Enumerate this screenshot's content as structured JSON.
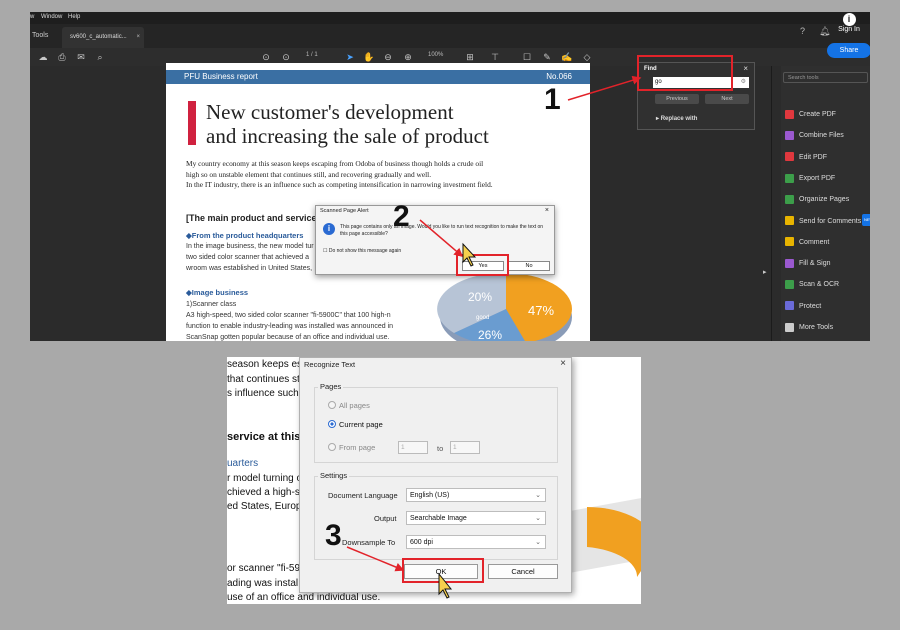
{
  "top": {
    "menu": [
      "w",
      "Window",
      "Help"
    ],
    "tools_tab": "Tools",
    "doc_tab": "sv600_c_automatic...",
    "page_indicator": "1 / 1",
    "zoom": "100%",
    "sign_in": "Sign In",
    "share": "Share",
    "page": {
      "banner_left": "PFU Business report",
      "banner_right": "No.066",
      "title_line1": "New customer's development",
      "title_line2": "and increasing the sale of product",
      "body1": "My country economy at this season keeps escaping from Odoba of business though holds a crude oil",
      "body2": "high so on unstable element that continues still, and recovering gradually and well.",
      "body3": "In the IT industry, there is an influence such as competing intensification in narrowing investment field.",
      "section": "[The main product and service a",
      "hq_heading": "◆From the product headquarters",
      "hq1": "In the image business, the new model tur",
      "hq2": "two sided color scanner that achieved a",
      "hq3": "wroom was established in United States,",
      "img_heading": "◆Image business",
      "img1": "1)Scanner class",
      "img2": "A3 high-speed, two sided color scanner \"fi-5900C\" that 100 high-n",
      "img3": "function to enable industry-leading was installed was announced in",
      "img4": "ScanSnap gotten popular because of an office and individual use.",
      "pie_labels": [
        "20%",
        "good",
        "26%",
        "47%"
      ]
    },
    "alert": {
      "title": "Scanned Page Alert",
      "message": "This page contains only an image. Would you like to run text recognition to make the text on this page accessible?",
      "dont_show": "Do not show this message again",
      "yes": "Yes",
      "no": "No"
    },
    "find": {
      "title": "Find",
      "value": "go",
      "previous": "Previous",
      "next": "Next",
      "replace": "Replace with"
    },
    "tools": {
      "search_placeholder": "Search tools",
      "items": [
        {
          "label": "Create PDF",
          "icon": "create-pdf-icon",
          "color": "#e0383e"
        },
        {
          "label": "Combine Files",
          "icon": "combine-files-icon",
          "color": "#9b59d0"
        },
        {
          "label": "Edit PDF",
          "icon": "edit-pdf-icon",
          "color": "#e0383e"
        },
        {
          "label": "Export PDF",
          "icon": "export-pdf-icon",
          "color": "#3c9e4a"
        },
        {
          "label": "Organize Pages",
          "icon": "organize-pages-icon",
          "color": "#3c9e4a"
        },
        {
          "label": "Send for Comments",
          "icon": "send-comments-icon",
          "color": "#e8b400"
        },
        {
          "label": "Comment",
          "icon": "comment-icon",
          "color": "#e8b400"
        },
        {
          "label": "Fill & Sign",
          "icon": "fill-sign-icon",
          "color": "#9b59d0"
        },
        {
          "label": "Scan & OCR",
          "icon": "scan-ocr-icon",
          "color": "#3c9e4a"
        },
        {
          "label": "Protect",
          "icon": "protect-icon",
          "color": "#6a6ad8"
        },
        {
          "label": "More Tools",
          "icon": "more-tools-icon",
          "color": "#cccccc"
        }
      ],
      "new_badge": "NEW"
    }
  },
  "bottom": {
    "bg_lines": [
      "season keeps esc",
      "that continues st",
      "s influence such",
      "service at this",
      "uarters",
      "r model turning o",
      "chieved a high-s",
      "ed States, Europ",
      "or scanner \"fi-59",
      "ading was instal",
      "use of an office and individual use."
    ],
    "dialog": {
      "title": "Recognize Text",
      "pages_label": "Pages",
      "all_pages": "All pages",
      "current_page": "Current page",
      "from_page": "From page",
      "from_value": "1",
      "to_label": "to",
      "to_value": "1",
      "settings_label": "Settings",
      "lang_label": "Document Language",
      "lang_value": "English (US)",
      "output_label": "Output",
      "output_value": "Searchable Image",
      "downsample_label": "Downsample To",
      "downsample_value": "600 dpi",
      "ok": "OK",
      "cancel": "Cancel"
    }
  },
  "annotations": {
    "n1": "1",
    "n2": "2",
    "n3": "3",
    "color": "#e2232a"
  }
}
